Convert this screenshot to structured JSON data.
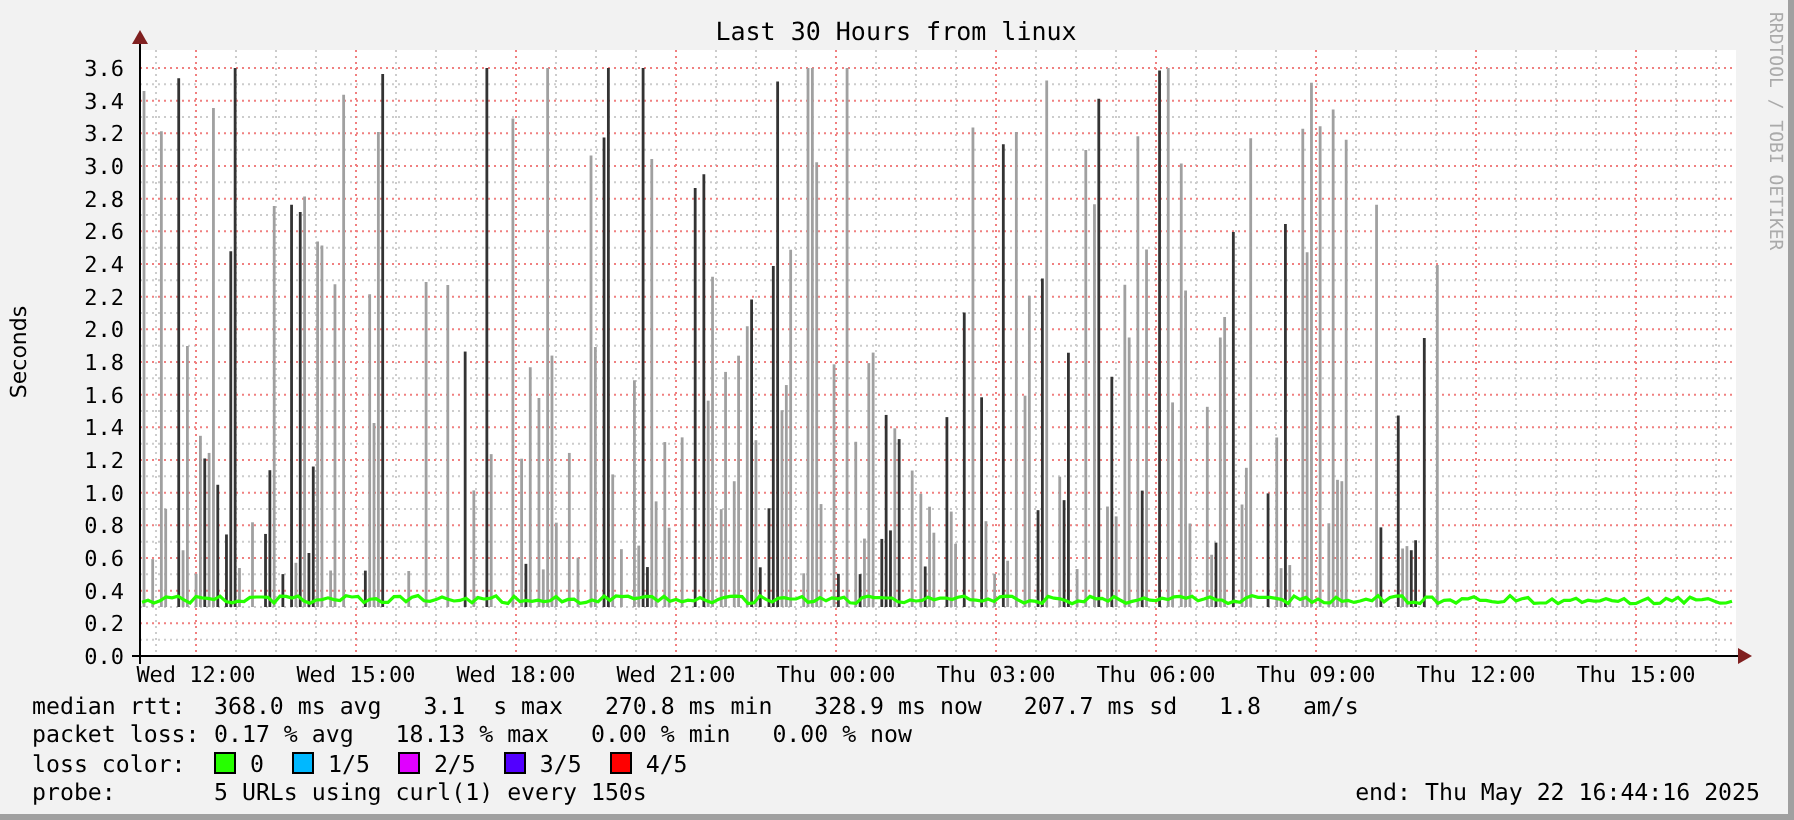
{
  "title": "Last 30 Hours from linux",
  "credit": "RRDTOOL / TOBI OETIKER",
  "y_axis": {
    "label": "Seconds",
    "ticks": [
      "3.6",
      "3.4",
      "3.2",
      "3.0",
      "2.8",
      "2.6",
      "2.4",
      "2.2",
      "2.0",
      "1.8",
      "1.6",
      "1.4",
      "1.2",
      "1.0",
      "0.8",
      "0.6",
      "0.4",
      "0.2",
      "0.0"
    ]
  },
  "x_axis": {
    "ticks": [
      "Wed 12:00",
      "Wed 15:00",
      "Wed 18:00",
      "Wed 21:00",
      "Thu 00:00",
      "Thu 03:00",
      "Thu 06:00",
      "Thu 09:00",
      "Thu 12:00",
      "Thu 15:00"
    ]
  },
  "legend": {
    "rows": [
      {
        "kind": "text",
        "label": "median rtt:",
        "text": "368.0 ms avg   3.1  s max   270.8 ms min   328.9 ms now   207.7 ms sd   1.8   am/s"
      },
      {
        "kind": "text",
        "label": "packet loss:",
        "text": "0.17 % avg   18.13 % max   0.00 % min   0.00 % now"
      },
      {
        "kind": "swatches",
        "label": "loss color:",
        "swatches": [
          {
            "label": "0",
            "color": "#26ff00"
          },
          {
            "label": "1/5",
            "color": "#00b8ff"
          },
          {
            "label": "2/5",
            "color": "#e000ff"
          },
          {
            "label": "3/5",
            "color": "#5200ff"
          },
          {
            "label": "4/5",
            "color": "#ff0000"
          }
        ]
      },
      {
        "kind": "text",
        "label": "probe:",
        "text": "5 URLs using curl(1) every 150s"
      }
    ],
    "end": "end: Thu May 22 16:44:16 2025"
  }
}
